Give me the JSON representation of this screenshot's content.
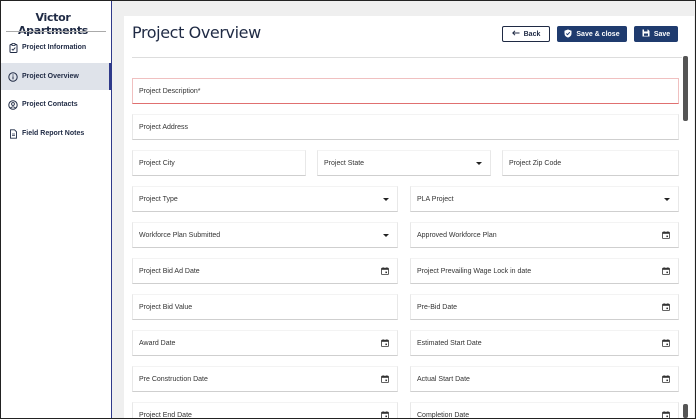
{
  "sidebar": {
    "title": "Victor Apartments",
    "items": [
      {
        "label": "Project Information",
        "icon": "clipboard-icon"
      },
      {
        "label": "Project Overview",
        "icon": "info-circle-icon",
        "active": true
      },
      {
        "label": "Project Contacts",
        "icon": "person-circle-icon"
      },
      {
        "label": "Field Report Notes",
        "icon": "document-icon"
      }
    ]
  },
  "header": {
    "title": "Project Overview",
    "back_label": "Back",
    "save_close_label": "Save & close",
    "save_label": "Save"
  },
  "form": {
    "project_description": "Project Description*",
    "project_address": "Project Address",
    "project_city": "Project City",
    "project_state": "Project State",
    "project_zip": "Project Zip Code",
    "project_type": "Project Type",
    "pla_project": "PLA Project",
    "workforce_plan_submitted": "Workforce Plan Submitted",
    "approved_workforce_plan": "Approved Workforce Plan",
    "project_bid_ad_date": "Project Bid Ad Date",
    "prevailing_wage_lock_date": "Project Prevailing Wage Lock in date",
    "project_bid_value": "Project Bid Value",
    "pre_bid_date": "Pre-Bid Date",
    "award_date": "Award Date",
    "estimated_start_date": "Estimated Start Date",
    "pre_construction_date": "Pre Construction Date",
    "actual_start_date": "Actual Start Date",
    "project_end_date": "Project End Date",
    "completion_date": "Completion Date"
  },
  "colors": {
    "brand": "#1f3b6e",
    "sidebar_active_bg": "#dfe3ea",
    "required_border": "#e07070"
  }
}
